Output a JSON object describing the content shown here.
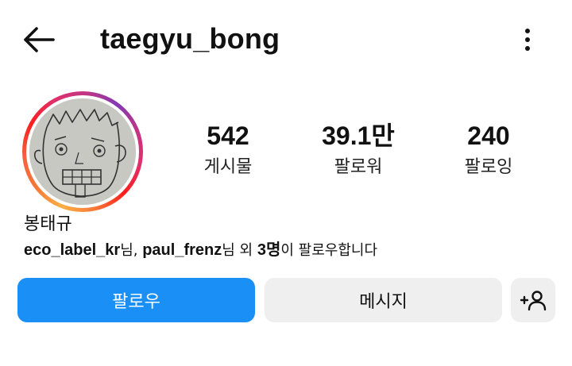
{
  "header": {
    "username": "taegyu_bong",
    "back_icon": "back-arrow-icon",
    "more_icon": "more-vertical-icon"
  },
  "profile": {
    "avatar": "hand-drawn face profile picture",
    "display_name": "봉태규"
  },
  "stats": [
    {
      "value": "542",
      "label": "게시물"
    },
    {
      "value": "39.1만",
      "label": "팔로워"
    },
    {
      "value": "240",
      "label": "팔로잉"
    }
  ],
  "followed_by": {
    "user1": "eco_label_kr",
    "suffix1": "님, ",
    "user2": "paul_frenz",
    "suffix2": "님 외 ",
    "count": "3명",
    "tail": "이 팔로우합니다"
  },
  "actions": {
    "follow_label": "팔로우",
    "message_label": "메시지",
    "suggest_icon": "add-person-icon",
    "suggest_glyph": "+"
  },
  "colors": {
    "follow_button": "#1a8ff5",
    "secondary_button": "#efefef",
    "story_ring": [
      "#fcaf45",
      "#f56040",
      "#e1306c",
      "#833ab4"
    ]
  }
}
